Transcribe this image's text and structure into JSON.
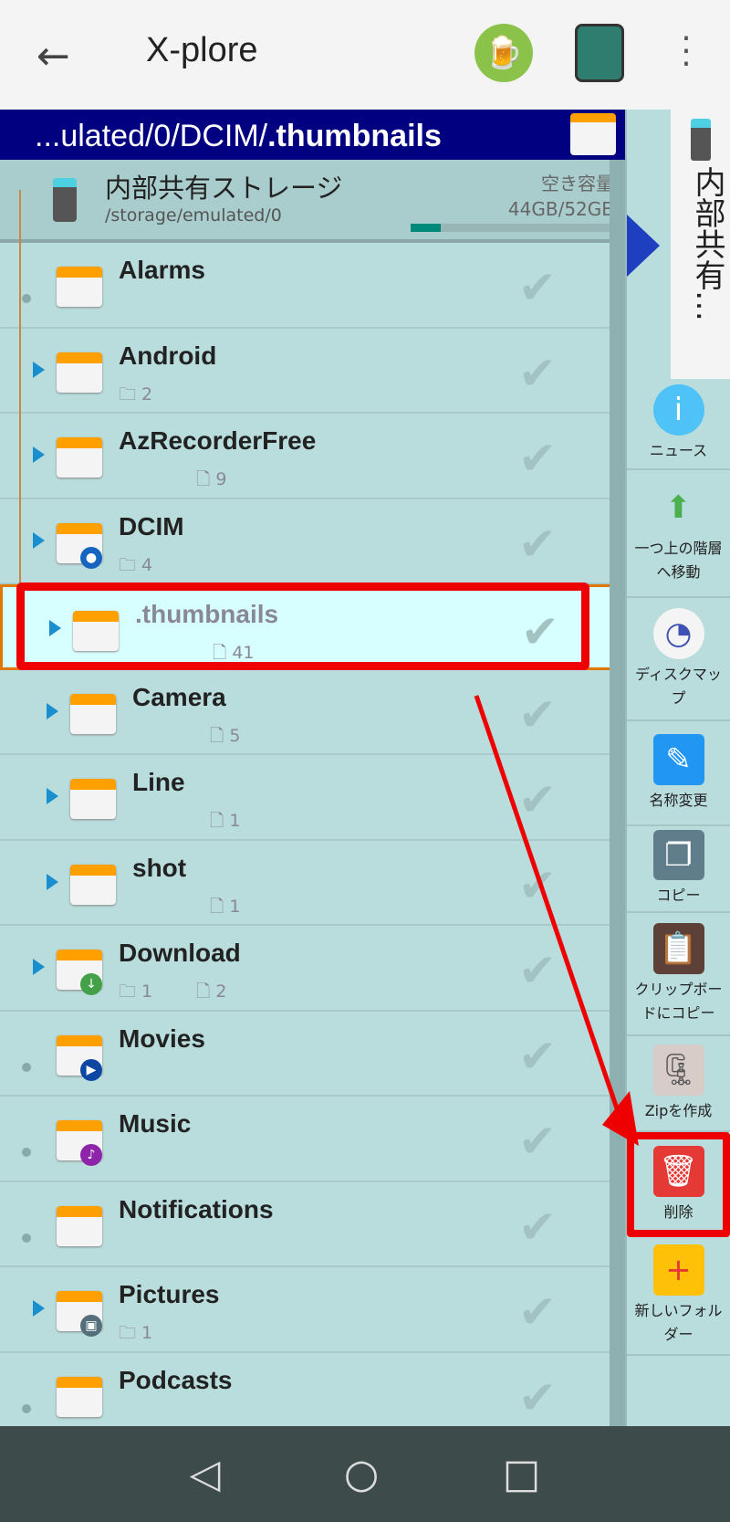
{
  "header": {
    "title": "X-plore",
    "back_icon": "arrow-left-icon",
    "beer_icon": "beer-icon",
    "devices_icon": "devices-icon",
    "more_icon": "more-vert-icon"
  },
  "path": {
    "prefix": "...ulated/0/DCIM/",
    "current": ".thumbnails"
  },
  "storage": {
    "name": "内部共有ストレージ",
    "path": "/storage/emulated/0",
    "free_label": "空き容量",
    "free_value": "44GB/52GB",
    "used_fraction": 0.15
  },
  "rows": [
    {
      "name": "Alarms",
      "level": 1,
      "expand": false,
      "folders": "",
      "files": ""
    },
    {
      "name": "Android",
      "level": 1,
      "expand": true,
      "folders": "2",
      "files": ""
    },
    {
      "name": "AzRecorderFree",
      "level": 1,
      "expand": true,
      "folders": "",
      "files": "9"
    },
    {
      "name": "DCIM",
      "level": 1,
      "expand": true,
      "folders": "4",
      "files": "",
      "badge": "camera"
    },
    {
      "name": ".thumbnails",
      "level": 2,
      "expand": true,
      "folders": "",
      "files": "41",
      "selected": true
    },
    {
      "name": "Camera",
      "level": 2,
      "expand": true,
      "folders": "",
      "files": "5"
    },
    {
      "name": "Line",
      "level": 2,
      "expand": true,
      "folders": "",
      "files": "1"
    },
    {
      "name": "shot",
      "level": 2,
      "expand": true,
      "folders": "",
      "files": "1"
    },
    {
      "name": "Download",
      "level": 1,
      "expand": true,
      "folders": "1",
      "files": "2",
      "badge": "download"
    },
    {
      "name": "Movies",
      "level": 1,
      "expand": false,
      "folders": "",
      "files": "",
      "badge": "play"
    },
    {
      "name": "Music",
      "level": 1,
      "expand": false,
      "folders": "",
      "files": "",
      "badge": "music"
    },
    {
      "name": "Notifications",
      "level": 1,
      "expand": false,
      "folders": "",
      "files": ""
    },
    {
      "name": "Pictures",
      "level": 1,
      "expand": true,
      "folders": "1",
      "files": "",
      "badge": "image"
    },
    {
      "name": "Podcasts",
      "level": 1,
      "expand": false,
      "folders": "",
      "files": ""
    }
  ],
  "side": {
    "tab_label": "内部共有…",
    "items": [
      {
        "label": "ニュース",
        "icon": "info-icon"
      },
      {
        "label": "一つ上の階層へ移動",
        "icon": "arrow-up-icon"
      },
      {
        "label": "ディスクマップ",
        "icon": "disk-map-icon"
      },
      {
        "label": "名称変更",
        "icon": "rename-icon"
      },
      {
        "label": "コピー",
        "icon": "copy-icon"
      },
      {
        "label": "クリップボードにコピー",
        "icon": "clipboard-icon"
      },
      {
        "label": "Zipを作成",
        "icon": "zip-icon"
      },
      {
        "label": "削除",
        "icon": "trash-icon",
        "highlight": true
      },
      {
        "label": "新しいフォルダー",
        "icon": "new-folder-icon"
      }
    ]
  },
  "colors": {
    "path_bar": "#000080",
    "list_bg": "#b9dcdc",
    "highlight": "#e00000",
    "selected": "#d8ffff"
  },
  "nav": {
    "back": "◁",
    "home": "○",
    "recent": "□"
  }
}
